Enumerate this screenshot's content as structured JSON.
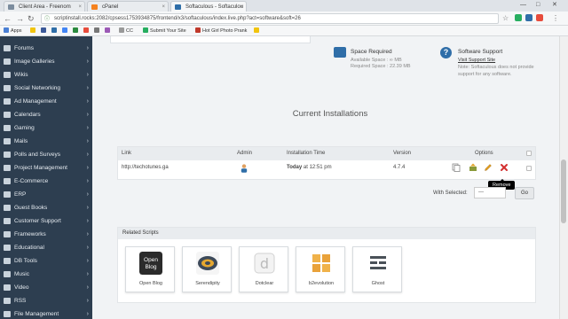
{
  "browser": {
    "tabs": [
      {
        "title": "Client Area - Freenom",
        "color": "#7b8c9e"
      },
      {
        "title": "cPanel",
        "color": "#f5821f"
      },
      {
        "title": "Softaculous - Softaculou",
        "color": "#2f6ea8"
      }
    ],
    "url": "scriptinstall.rocks:2082/cpsess1753934875/frontend/x3/softaculous/index.live.php?act=software&soft=26",
    "bookmarks": [
      "Apps",
      "CC",
      "Submit Your Site",
      "Hot Girl Photo Prank"
    ]
  },
  "sidebar": {
    "items": [
      {
        "label": "Forums"
      },
      {
        "label": "Image Galleries"
      },
      {
        "label": "Wikis"
      },
      {
        "label": "Social Networking"
      },
      {
        "label": "Ad Management"
      },
      {
        "label": "Calendars"
      },
      {
        "label": "Gaming"
      },
      {
        "label": "Mails"
      },
      {
        "label": "Polls and Surveys"
      },
      {
        "label": "Project Management"
      },
      {
        "label": "E-Commerce"
      },
      {
        "label": "ERP"
      },
      {
        "label": "Guest Books"
      },
      {
        "label": "Customer Support"
      },
      {
        "label": "Frameworks"
      },
      {
        "label": "Educational"
      },
      {
        "label": "DB Tools"
      },
      {
        "label": "Music"
      },
      {
        "label": "Video"
      },
      {
        "label": "RSS"
      },
      {
        "label": "File Management"
      }
    ]
  },
  "info": {
    "space": {
      "title": "Space Required",
      "available": "Available Space : ∞ MB",
      "required": "Required Space : 22.39 MB"
    },
    "support": {
      "title": "Software Support",
      "link": "Visit Support Site",
      "note": "Note: Softaculous does not provide support for any software."
    }
  },
  "installs": {
    "title": "Current Installations",
    "headers": {
      "link": "Link",
      "admin": "Admin",
      "time": "Installation Time",
      "version": "Version",
      "options": "Options"
    },
    "rows": [
      {
        "link": "http://techotunes.ga",
        "time_bold": "Today",
        "time_rest": " at 12:51 pm",
        "version": "4.7.4"
      }
    ],
    "tooltip": "Remove",
    "with_selected": "With Selected:",
    "select_value": "---",
    "go": "Go"
  },
  "related": {
    "title": "Related Scripts",
    "scripts": [
      {
        "name": "Open Blog",
        "logo_text": "Open Blog",
        "color": "#2b2b2b"
      },
      {
        "name": "Serendipity",
        "logo_text": "",
        "color": "#3d4a5a"
      },
      {
        "name": "Dotclear",
        "logo_text": "d",
        "color": "#e9e9e9"
      },
      {
        "name": "b2evolution",
        "logo_text": "",
        "color": "#f0b24a"
      },
      {
        "name": "Ghost",
        "logo_text": "",
        "color": "#4a5158"
      }
    ]
  }
}
